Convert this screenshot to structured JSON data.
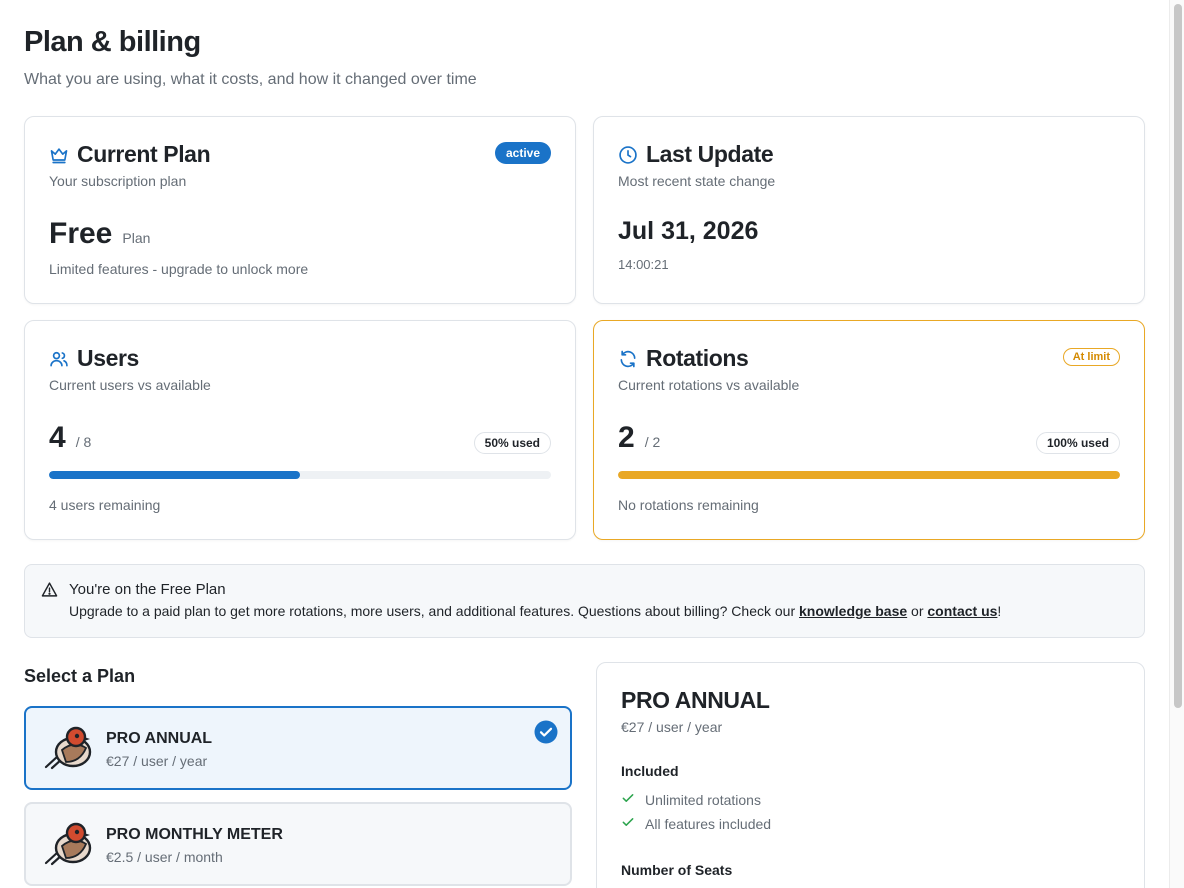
{
  "header": {
    "title": "Plan & billing",
    "subtitle": "What you are using, what it costs, and how it changed over time"
  },
  "current_plan": {
    "icon": "crown-icon",
    "title": "Current Plan",
    "description": "Your subscription plan",
    "status": "active",
    "plan_name": "Free",
    "plan_suffix": "Plan",
    "note": "Limited features - upgrade to unlock more"
  },
  "last_update": {
    "icon": "clock-icon",
    "title": "Last Update",
    "description": "Most recent state change",
    "date": "Jul 31, 2026",
    "time": "14:00:21"
  },
  "users": {
    "icon": "users-icon",
    "title": "Users",
    "description": "Current users vs available",
    "current": "4",
    "total": "/ 8",
    "usage_label": "50% used",
    "usage_fraction": 0.5,
    "remaining": "4 users remaining",
    "color": "#1a73c8"
  },
  "rotations": {
    "icon": "refresh-icon",
    "title": "Rotations",
    "description": "Current rotations vs available",
    "status": "At limit",
    "current": "2",
    "total": "/ 2",
    "usage_label": "100% used",
    "usage_fraction": 1.0,
    "remaining": "No rotations remaining",
    "color": "#e9a825"
  },
  "banner": {
    "icon": "warning-icon",
    "title": "You're on the Free Plan",
    "text_before": "Upgrade to a paid plan to get more rotations, more users, and additional features. Questions about billing? Check our ",
    "link_kb": "knowledge base",
    "text_mid": " or ",
    "link_contact": "contact us",
    "text_after": "!"
  },
  "plans": {
    "section_title": "Select a Plan",
    "options": [
      {
        "name": "PRO ANNUAL",
        "price": "€27 / user / year",
        "selected": true
      },
      {
        "name": "PRO MONTHLY METER",
        "price": "€2.5 / user / month",
        "selected": false
      }
    ]
  },
  "detail": {
    "title": "PRO ANNUAL",
    "price": "€27 / user / year",
    "included_label": "Included",
    "features": [
      "Unlimited rotations",
      "All features included"
    ],
    "seats_label": "Number of Seats"
  },
  "colors": {
    "accent": "#1a73c8",
    "warning": "#e9a825",
    "success": "#2da44e"
  }
}
